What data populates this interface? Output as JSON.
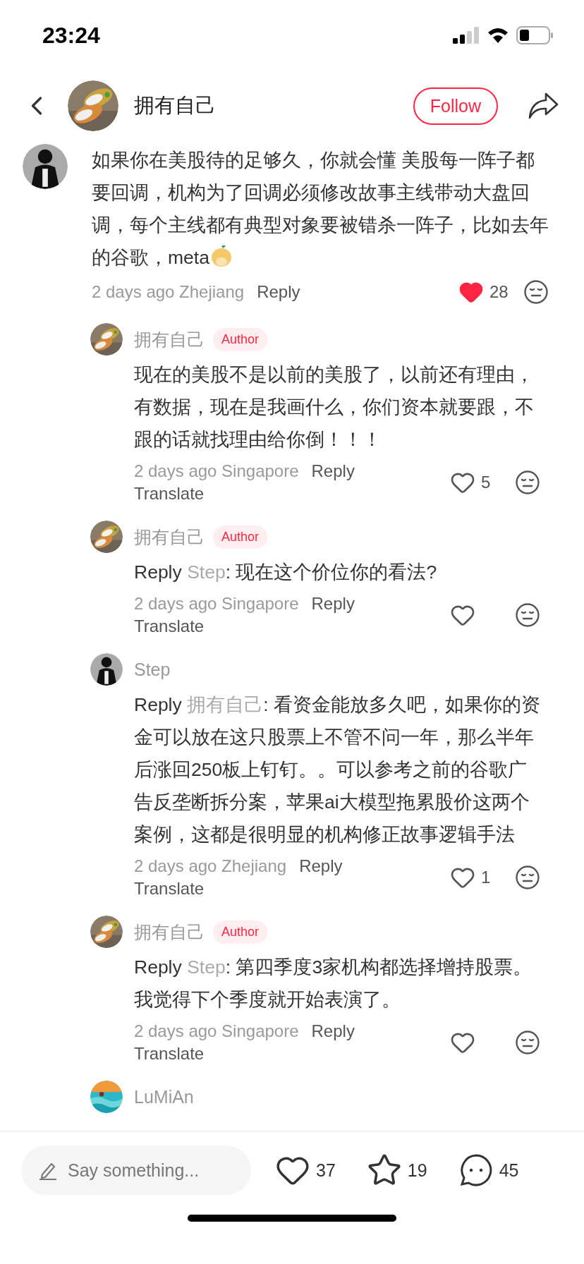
{
  "status_bar": {
    "time": "23:24"
  },
  "header": {
    "author": "拥有自己",
    "follow": "Follow"
  },
  "comments": [
    {
      "kind": "top",
      "body": "如果你在美股待的足够久，你就会懂 美股每一阵子都要回调，机构为了回调必须修改故事主线带动大盘回调，每个主线都有典型对象要被错杀一阵子，比如去年的谷歌，meta",
      "sticker": true,
      "time": "2 days ago Zhejiang",
      "reply": "Reply",
      "liked": true,
      "likes": "28"
    },
    {
      "kind": "reply",
      "name": "拥有自己",
      "badge": "Author",
      "body": "现在的美股不是以前的美股了，以前还有理由，有数据，现在是我画什么，你们资本就要跟，不跟的话就找理由给你倒！！！",
      "time": "2 days ago Singapore",
      "reply": "Reply",
      "translate": "Translate",
      "liked": false,
      "likes": "5"
    },
    {
      "kind": "reply",
      "name": "拥有自己",
      "badge": "Author",
      "reply_prefix": "Reply",
      "reply_to": "Step",
      "body": ": 现在这个价位你的看法?",
      "time": "2 days ago Singapore",
      "reply": "Reply",
      "translate": "Translate",
      "liked": false
    },
    {
      "kind": "reply",
      "name": "Step",
      "reply_prefix": "Reply",
      "reply_to": "拥有自己",
      "body": ": 看资金能放多久吧，如果你的资金可以放在这只股票上不管不问一年，那么半年后涨回250板上钉钉。。可以参考之前的谷歌广告反垄断拆分案，苹果ai大模型拖累股价这两个案例，这都是很明显的机构修正故事逻辑手法",
      "time": "2 days ago Zhejiang",
      "reply": "Reply",
      "translate": "Translate",
      "liked": false,
      "likes": "1"
    },
    {
      "kind": "reply",
      "name": "拥有自己",
      "badge": "Author",
      "reply_prefix": "Reply",
      "reply_to": "Step",
      "body": ": 第四季度3家机构都选择增持股票。我觉得下个季度就开始表演了。",
      "time": "2 days ago Singapore",
      "reply": "Reply",
      "translate": "Translate",
      "liked": false
    },
    {
      "kind": "reply",
      "name": "LuMiAn"
    }
  ],
  "bottom_bar": {
    "placeholder": "Say something...",
    "likes": "37",
    "stars": "19",
    "comments": "45"
  }
}
